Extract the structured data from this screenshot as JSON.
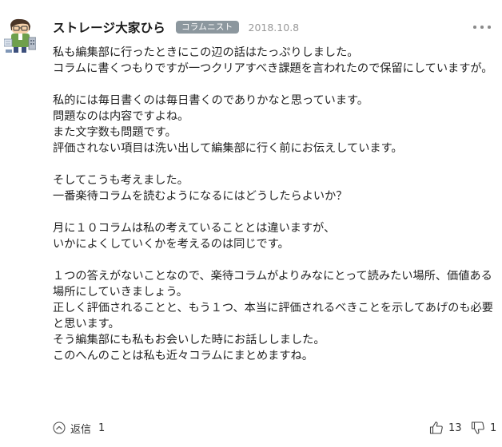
{
  "comment": {
    "author": "ストレージ大家ひら",
    "badge": "コラムニスト",
    "date": "2018.10.8",
    "paragraphs": [
      [
        "私も編集部に行ったときにこの辺の話はたっぷりしました。",
        "コラムに書くつもりですが一つクリアすべき課題を言われたので保留にしていますが。"
      ],
      [
        "私的には毎日書くのは毎日書くのでありかなと思っています。",
        "問題なのは内容ですよね。",
        "また文字数も問題です。",
        "評価されない項目は洗い出して編集部に行く前にお伝えしています。"
      ],
      [
        "そしてこうも考えました。",
        "一番楽待コラムを読むようになるにはどうしたらよいか？"
      ],
      [
        "月に１０コラムは私の考えていることとは違いますが、",
        "いかによくしていくかを考えるのは同じです。"
      ],
      [
        "１つの答えがないことなので、楽待コラムがよりみなにとって読みたい場所、価値ある場所にしていきましょう。",
        "正しく評価されることと、もう１つ、本当に評価されるべきことを示してあげのも必要と思います。",
        "そう編集部にも私もお会いした時にお話ししました。",
        "このへんのことは私も近々コラムにまとめますね。"
      ]
    ],
    "reply_label": "返信",
    "reply_count": "1",
    "upvote_count": "13",
    "downvote_count": "1"
  },
  "icons": {
    "avatar": "avatar-illustration",
    "more": "more-dots-icon",
    "reply": "chevron-up-circle-icon",
    "upvote": "thumbs-up-icon",
    "downvote": "thumbs-down-icon"
  },
  "colors": {
    "badge_bg": "#8c979e",
    "date_text": "#999999",
    "body_text": "#222222"
  }
}
